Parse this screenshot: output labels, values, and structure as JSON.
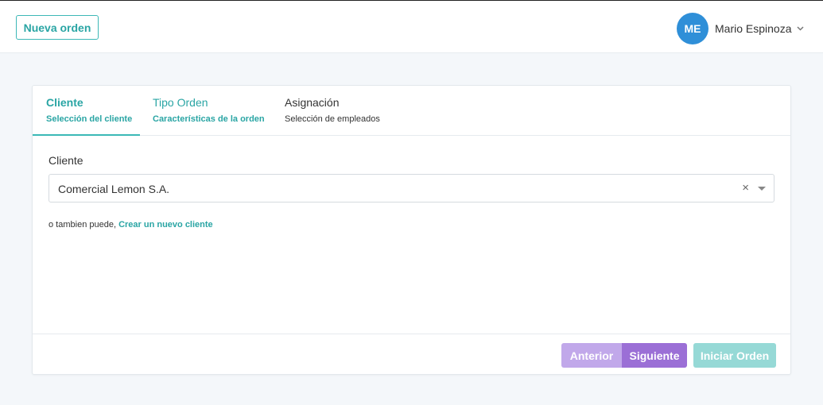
{
  "header": {
    "new_order_label": "Nueva orden",
    "user": {
      "initials": "ME",
      "name": "Mario Espinoza"
    }
  },
  "tabs": [
    {
      "title": "Cliente",
      "subtitle": "Selección del cliente",
      "state": "active"
    },
    {
      "title": "Tipo Orden",
      "subtitle": "Características de la orden",
      "state": "enabled"
    },
    {
      "title": "Asignación",
      "subtitle": "Selección de empleados",
      "state": "pending"
    }
  ],
  "form": {
    "client_label": "Cliente",
    "client_value": "Comercial Lemon S.A.",
    "clear_symbol": "×",
    "hint_text": "o tambien puede,",
    "hint_link": "Crear un nuevo cliente"
  },
  "footer": {
    "prev_label": "Anterior",
    "next_label": "Siguiente",
    "start_label": "Iniciar Orden"
  },
  "colors": {
    "accent_teal": "#2aa5a4",
    "avatar_blue": "#2f8fd8",
    "purple": "#9b6fd6",
    "purple_light": "#c1a8ea",
    "teal_light": "#96d9d6"
  },
  "icons": {
    "user_menu": "chevron-down-icon",
    "select_clear": "close-icon",
    "select_toggle": "caret-down-icon"
  }
}
